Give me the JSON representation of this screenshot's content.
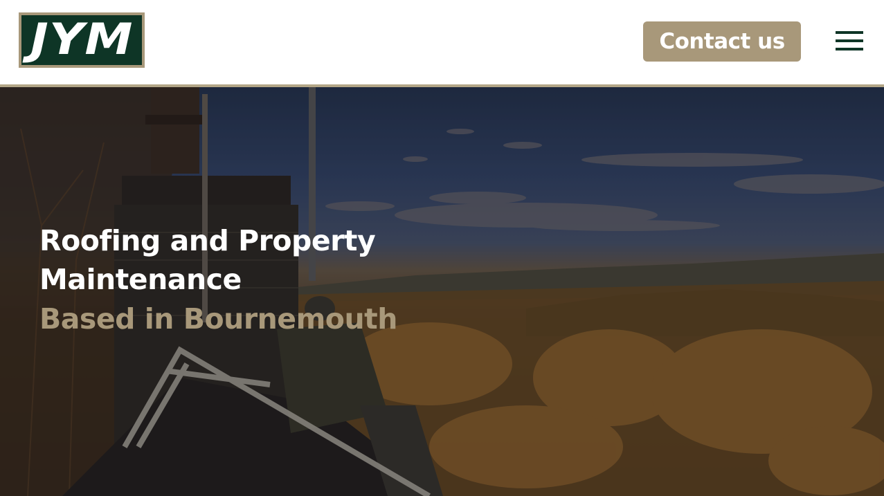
{
  "header": {
    "logo_text": "JYM",
    "contact_label": "Contact us"
  },
  "hero": {
    "title_line1": "Roofing and Property",
    "title_line2": "Maintenance",
    "subtitle": "Based in Bournemouth"
  },
  "colors": {
    "brand_green": "#0e3526",
    "accent_gold": "#a8987a",
    "text_white": "#ffffff"
  },
  "icons": {
    "menu": "hamburger-menu-icon"
  }
}
